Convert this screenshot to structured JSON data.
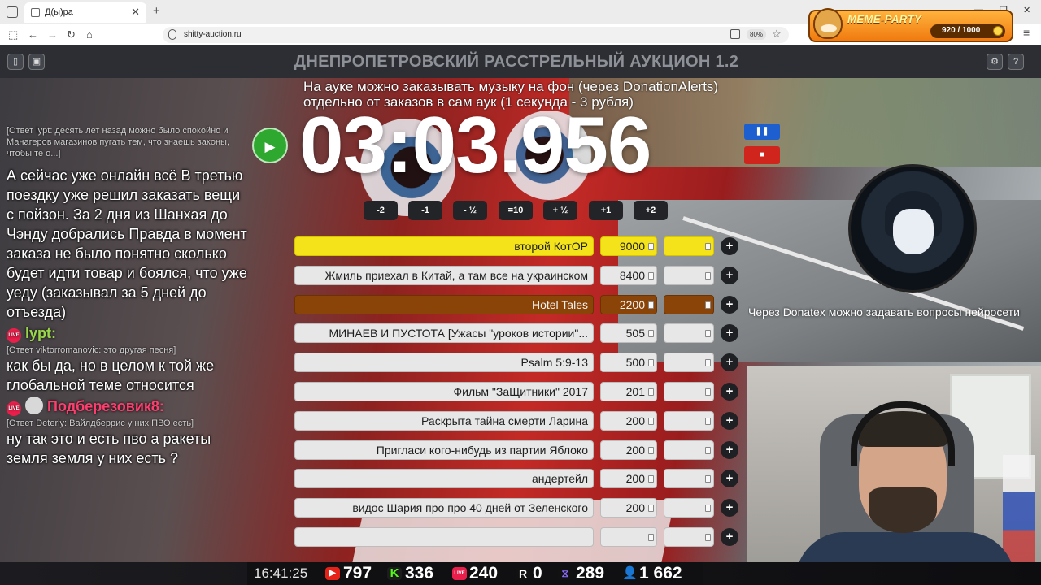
{
  "browser": {
    "tab_title": "Д(ы)ра",
    "url": "shitty-auction.ru",
    "zoom": "80%",
    "meme_party": {
      "title": "MEME-PARTY",
      "score": "920 / 1000"
    }
  },
  "app": {
    "title": "ДНЕПРОПЕТРОВСКИЙ РАССТРЕЛЬНЫЙ АУКЦИОН 1.2",
    "info_line1": "На ауке можно заказывать музыку на фон (через DonationAlerts)",
    "info_line2": "отдельно от заказов в сам аук (1 секунда - 3 рубля)",
    "timer": "03:03.956",
    "adjust_buttons": [
      "-2",
      "-1",
      "- ½",
      "=10",
      "+ ½",
      "+1",
      "+2"
    ],
    "lots": [
      {
        "name": "второй КотОР",
        "amount": "9000",
        "style": "first"
      },
      {
        "name": "Жмиль приехал в Китай, а там все на украинском",
        "amount": "8400",
        "style": ""
      },
      {
        "name": "Hotel Tales",
        "amount": "2200",
        "style": "third"
      },
      {
        "name": "МИНАЕВ И ПУСТОТА [Ужасы \"уроков истории\"...",
        "amount": "505",
        "style": ""
      },
      {
        "name": "Psalm 5:9-13",
        "amount": "500",
        "style": ""
      },
      {
        "name": "Фильм \"ЗаЩитники\" 2017",
        "amount": "201",
        "style": ""
      },
      {
        "name": "Раскрыта тайна смерти Ларина",
        "amount": "200",
        "style": ""
      },
      {
        "name": "Пригласи кого-нибудь из партии Яблоко",
        "amount": "200",
        "style": ""
      },
      {
        "name": "андертейл",
        "amount": "200",
        "style": ""
      },
      {
        "name": "видос Шария про про 40 дней от Зеленского",
        "amount": "200",
        "style": ""
      },
      {
        "name": "",
        "amount": "",
        "style": ""
      }
    ],
    "plus_label": "+"
  },
  "chat": {
    "top_reply": "[Ответ lypt: десять лет назад можно было спокойно и Манагеров магазинов пугать тем, что знаешь законы, чтобы те о...]",
    "msg1": "А сейчас уже онлайн всё В третью поездку уже решил заказать вещи с пойзон. За 2 дня из Шанхая до Чэнду добрались Правда в момент заказа не было понятно сколько будет идти товар и боялся, что уже уеду (заказывал за 5 дней до отъезда)",
    "user2": "lypt:",
    "reply2": "[Ответ viktorromanovic: это другая песня]",
    "msg2": "как бы да, но в целом к той же глобальной теме относится",
    "user3": "Подберезовик8:",
    "reply3": "[Ответ Deterly: Вайлдберрис у них ПВО есть]",
    "msg3": "ну так это и есть пво а ракеты земля земля у них есть ?",
    "live_label": "LIVE"
  },
  "ticker": "Через Donatex можно задавать вопросы нейросети",
  "stats": {
    "time": "16:41:25",
    "youtube": "797",
    "kick": "336",
    "vklive": "240",
    "rutube": "0",
    "trovo": "289",
    "total": "1 662"
  }
}
